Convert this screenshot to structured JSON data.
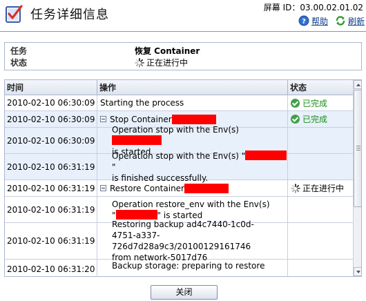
{
  "header": {
    "title": "任务详细信息",
    "screen_id": "屏幕 ID：03.00.02.01.02",
    "help_label": "帮助",
    "refresh_label": "刷新"
  },
  "task_info": {
    "task_label": "任务",
    "task_value": "恢复 Container",
    "status_label": "状态",
    "status_value": "正在进行中"
  },
  "log": {
    "columns": [
      "时间",
      "操作",
      "状态"
    ],
    "rows": [
      {
        "time": "2010-02-10 06:30:09",
        "op": "Starting the process",
        "status": "已完成"
      },
      {
        "time": "2010-02-10 06:30:09",
        "op": "Stop Container",
        "status": "已完成"
      },
      {
        "time": "2010-02-10 06:30:09",
        "op_a": "Operation stop with the Env(s)",
        "op_b": "is started"
      },
      {
        "time": "2010-02-10 06:31:19",
        "op_a": "Operation stop with the Env(s) \"",
        "op_a2": "\"",
        "op_b": "is finished successfully."
      },
      {
        "time": "2010-02-10 06:31:19",
        "op": "Restore Container",
        "status": "正在进行中"
      },
      {
        "time": "2010-02-10 06:31:19",
        "op_a": "Operation restore_env with the Env(s)",
        "op_b1": "\"",
        "op_b2": "\" is started"
      },
      {
        "time": "2010-02-10 06:31:19",
        "op_a": "Restoring backup ad4c7440-1c0d-",
        "op_b": "4751-a337-726d7d28a9c3/20100129161746",
        "op_c": "from network-5017d76"
      },
      {
        "time": "2010-02-10 06:31:20",
        "op_a": "Backup storage: preparing to restore"
      }
    ]
  },
  "close_label": "关闭",
  "colors": {
    "accent": "#7e94c6",
    "highlight_row": "#e8f1fb",
    "redaction": "#ff0000",
    "done_text": "#1a8f1a"
  }
}
